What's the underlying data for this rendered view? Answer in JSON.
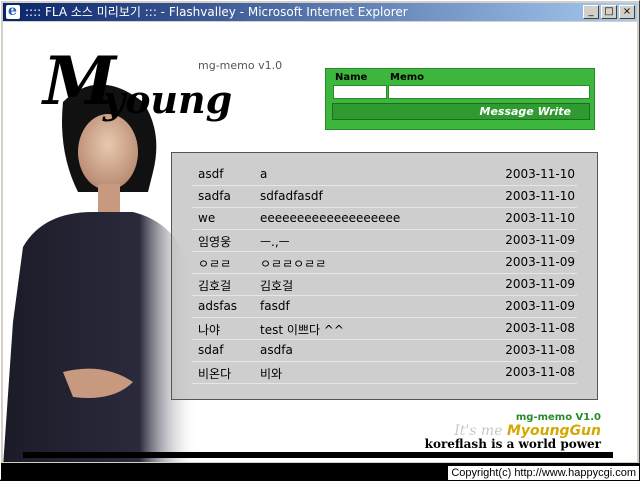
{
  "window": {
    "title": ":::: FLA 소스 미리보기 ::: - Flashvalley - Microsoft Internet Explorer",
    "buttons": [
      "_",
      "□",
      "×"
    ]
  },
  "logo": {
    "big_letter": "M",
    "rest": "young",
    "version": "mg-memo v1.0"
  },
  "form": {
    "name_label": "Name",
    "memo_label": "Memo",
    "submit_label": "Message Write"
  },
  "entries": [
    {
      "name": "asdf",
      "memo": "a",
      "date": "2003-11-10"
    },
    {
      "name": "sadfa",
      "memo": "sdfadfasdf",
      "date": "2003-11-10"
    },
    {
      "name": "we",
      "memo": "eeeeeeeeeeeeeeeeeee",
      "date": "2003-11-10"
    },
    {
      "name": "임영웅",
      "memo": "ㅡ.,ㅡ",
      "date": "2003-11-09"
    },
    {
      "name": "ㅇㄹㄹ",
      "memo": "ㅇㄹㄹㅇㄹㄹ",
      "date": "2003-11-09"
    },
    {
      "name": "김호걸",
      "memo": "김호걸",
      "date": "2003-11-09"
    },
    {
      "name": "adsfas",
      "memo": "fasdf",
      "date": "2003-11-09"
    },
    {
      "name": "나야",
      "memo": "test 이쁘다 ^^",
      "date": "2003-11-08"
    },
    {
      "name": "sdaf",
      "memo": "asdfa",
      "date": "2003-11-08"
    },
    {
      "name": "비온다",
      "memo": "비와",
      "date": "2003-11-08"
    }
  ],
  "signature": {
    "version": "mg-memo V1.0",
    "its_me": "It's me",
    "author": "MyoungGun",
    "tagline": "koreflash is a world power"
  },
  "copyright": "Copyright(c) http://www.happycgi.com"
}
